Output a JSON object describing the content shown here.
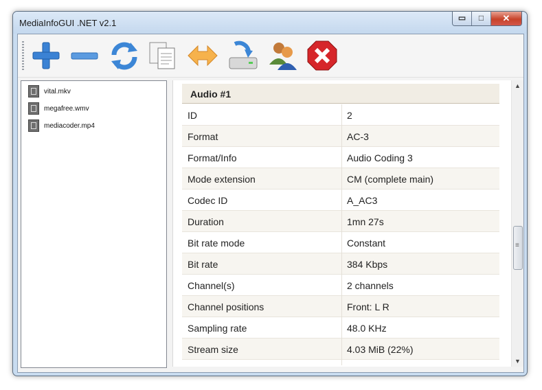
{
  "window": {
    "title": "MediaInfoGUI .NET v2.1",
    "controls": {
      "minimize_glyph": "▭",
      "maximize_glyph": "□",
      "close_glyph": "✕"
    }
  },
  "toolbar": {
    "buttons": [
      {
        "name": "add",
        "icon": "plus-icon",
        "color": "#3a7fd0"
      },
      {
        "name": "remove",
        "icon": "minus-icon",
        "color": "#3a7fd0"
      },
      {
        "name": "refresh",
        "icon": "refresh-icon",
        "color": "#3a7fd0"
      },
      {
        "name": "copy",
        "icon": "copy-icon",
        "color": "#8a8a8a"
      },
      {
        "name": "compare",
        "icon": "double-arrow-icon",
        "color": "#f2a23a"
      },
      {
        "name": "save",
        "icon": "save-drive-icon",
        "color": "#3a7fd0"
      },
      {
        "name": "users",
        "icon": "users-icon",
        "color": "#e08a2a"
      },
      {
        "name": "close",
        "icon": "stop-x-icon",
        "color": "#d42a2a"
      }
    ]
  },
  "files": [
    "vital.mkv",
    "megafree.wmv",
    "mediacoder.mp4"
  ],
  "details": {
    "section_title": "Audio #1",
    "rows": [
      {
        "key": "ID",
        "value": "2"
      },
      {
        "key": "Format",
        "value": "AC-3"
      },
      {
        "key": "Format/Info",
        "value": "Audio Coding 3"
      },
      {
        "key": "Mode extension",
        "value": "CM (complete main)"
      },
      {
        "key": "Codec ID",
        "value": "A_AC3"
      },
      {
        "key": "Duration",
        "value": "1mn 27s"
      },
      {
        "key": "Bit rate mode",
        "value": "Constant"
      },
      {
        "key": "Bit rate",
        "value": "384 Kbps"
      },
      {
        "key": "Channel(s)",
        "value": "2 channels"
      },
      {
        "key": "Channel positions",
        "value": "Front: L R"
      },
      {
        "key": "Sampling rate",
        "value": "48.0 KHz"
      },
      {
        "key": "Stream size",
        "value": "4.03 MiB (22%)"
      }
    ]
  },
  "scrollbar": {
    "up_glyph": "▲",
    "down_glyph": "▼"
  }
}
